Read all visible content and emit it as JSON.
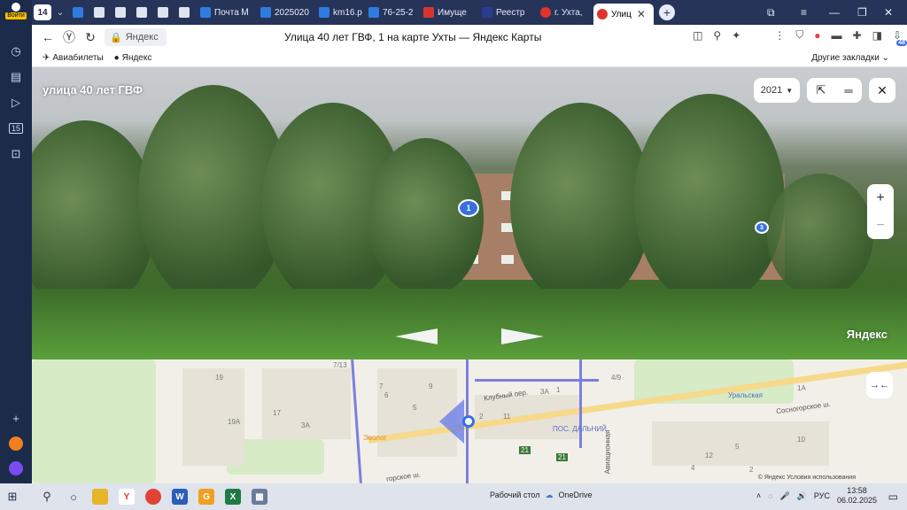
{
  "sidebar": {
    "login_label": "Войти",
    "calendar_label": "15"
  },
  "tabbar": {
    "counter": "14",
    "tabs": [
      {
        "label": "",
        "fav": "blue"
      },
      {
        "label": "",
        "fav": "doc"
      },
      {
        "label": "",
        "fav": "img"
      },
      {
        "label": "",
        "fav": "img"
      },
      {
        "label": "",
        "fav": "img"
      },
      {
        "label": "",
        "fav": "img"
      },
      {
        "label": "Почта Ꮇ",
        "fav": "blue"
      },
      {
        "label": "2025020",
        "fav": "blue"
      },
      {
        "label": "km16.p",
        "fav": "blue"
      },
      {
        "label": "76-25-2",
        "fav": "blue"
      },
      {
        "label": "Имуще",
        "fav": "red"
      },
      {
        "label": "Реестр",
        "fav": "navy"
      },
      {
        "label": "г. Ухта,",
        "fav": "yred"
      }
    ],
    "active_tab": "Улиц",
    "close_glyph": "✕",
    "new_tab_glyph": "+"
  },
  "addressbar": {
    "omni_label": "Яндекс",
    "page_title": "Улица 40 лет ГВФ, 1 на карте Ухты — Яндекс Карты",
    "download_badge": "48"
  },
  "bookmarks": {
    "items": [
      "Авиабилеты",
      "Яндекс"
    ],
    "other": "Другие закладки"
  },
  "panorama": {
    "street_title": "улица 40 лет ГВФ",
    "year": "2021",
    "marker1": "1",
    "marker3": "3",
    "brand": "Яндекс",
    "zoom_in": "+",
    "zoom_out": "−",
    "close_glyph": "✕"
  },
  "map": {
    "labels": {
      "l1": "7/13",
      "l2": "19",
      "l3": "19А",
      "l4": "17",
      "l5": "3А",
      "l6": "7",
      "l7": "9",
      "l8": "6",
      "l9": "5",
      "l10": "2",
      "l11": "11",
      "l12": "3А",
      "l13": "1",
      "l14": "4/9",
      "l15": "1А",
      "l16": "10",
      "l17": "12",
      "l18": "Клубный пер.",
      "l19": "ПОС. ДАЛЬНИЙ",
      "l20": "Сосногорское ш.",
      "l21": "горское ш.",
      "l22": "Авиационная",
      "l23": "Уральская",
      "l24": "Эволог",
      "l25": "21",
      "l26": "21",
      "l27": "4",
      "l28": "5",
      "l29": "2"
    },
    "copyright": "© Яндекс   Условия использования",
    "collapse_glyph": "→←"
  },
  "taskbar": {
    "desktop_label": "Рабочий стол",
    "onedrive_label": "OneDrive",
    "language": "РУС",
    "time": "13:58",
    "date": "06.02.2025"
  },
  "colors": {
    "sidebar": "#1c2b4a",
    "tabbar": "#26345a",
    "accent": "#3770e0",
    "map_road": "#7a7fe0"
  }
}
